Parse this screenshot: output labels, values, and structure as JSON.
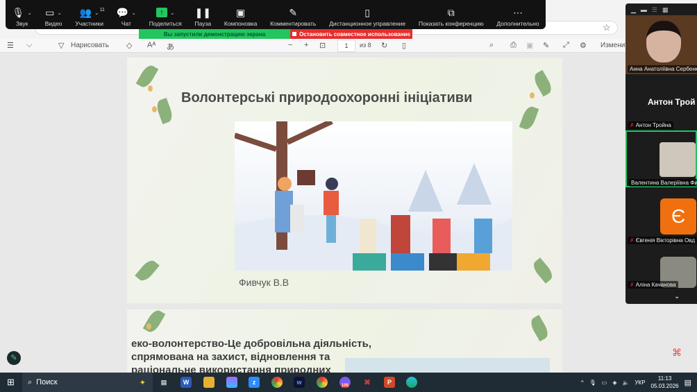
{
  "zoom_toolbar": [
    {
      "label": "Звук",
      "icon": "microphone-icon",
      "glyph": "🎙"
    },
    {
      "label": "Видео",
      "icon": "video-camera-icon",
      "glyph": "▭"
    },
    {
      "label": "Участники",
      "icon": "participants-icon",
      "glyph": "👥",
      "count": "11"
    },
    {
      "label": "Чат",
      "icon": "chat-icon",
      "glyph": "💬"
    },
    {
      "label": "Поделиться",
      "icon": "share-icon",
      "glyph": "↑"
    },
    {
      "label": "Пауза",
      "icon": "pause-icon",
      "glyph": "❚❚"
    },
    {
      "label": "Компоновка",
      "icon": "layout-icon",
      "glyph": "▣"
    },
    {
      "label": "Комментировать",
      "icon": "pencil-icon",
      "glyph": "✎"
    },
    {
      "label": "Дистанционное управление",
      "icon": "mouse-icon",
      "glyph": "▯"
    },
    {
      "label": "Показать конференцию",
      "icon": "show-meeting-icon",
      "glyph": "⧉"
    },
    {
      "label": "Дополнительно",
      "icon": "more-icon",
      "glyph": "⋯"
    }
  ],
  "banner": {
    "sharing": "Вы запустили демонстрацию экрана",
    "stop": "Остановить совместное использование"
  },
  "pdf_toolbar": {
    "draw": "Нарисовать",
    "page": "1",
    "of": "из 8",
    "edit": "Изменит"
  },
  "slide1": {
    "title": "Волонтерські природоохоронні ініціативи",
    "author": "Фивчук В.В"
  },
  "slide2": {
    "text": "еко-волонтерство-Це добровільна діяльність, спрямована на захист, відновлення та раціональне використання природних"
  },
  "participants": {
    "speaker_banner": "Антон Трой",
    "tiles": [
      {
        "name": "Анна Анатоліївна Сербенко"
      },
      {
        "name": "Антон Тройна"
      },
      {
        "name": "Валентина Валеріївна Фив"
      },
      {
        "name": "Євгенія Вікторівна Овд",
        "initial": "Є"
      },
      {
        "name": "Аліна Качанова"
      }
    ]
  },
  "taskbar": {
    "search": "Поиск",
    "lang": "УКР",
    "time": "11:13",
    "date": "05.03.2026",
    "badge": "105"
  }
}
